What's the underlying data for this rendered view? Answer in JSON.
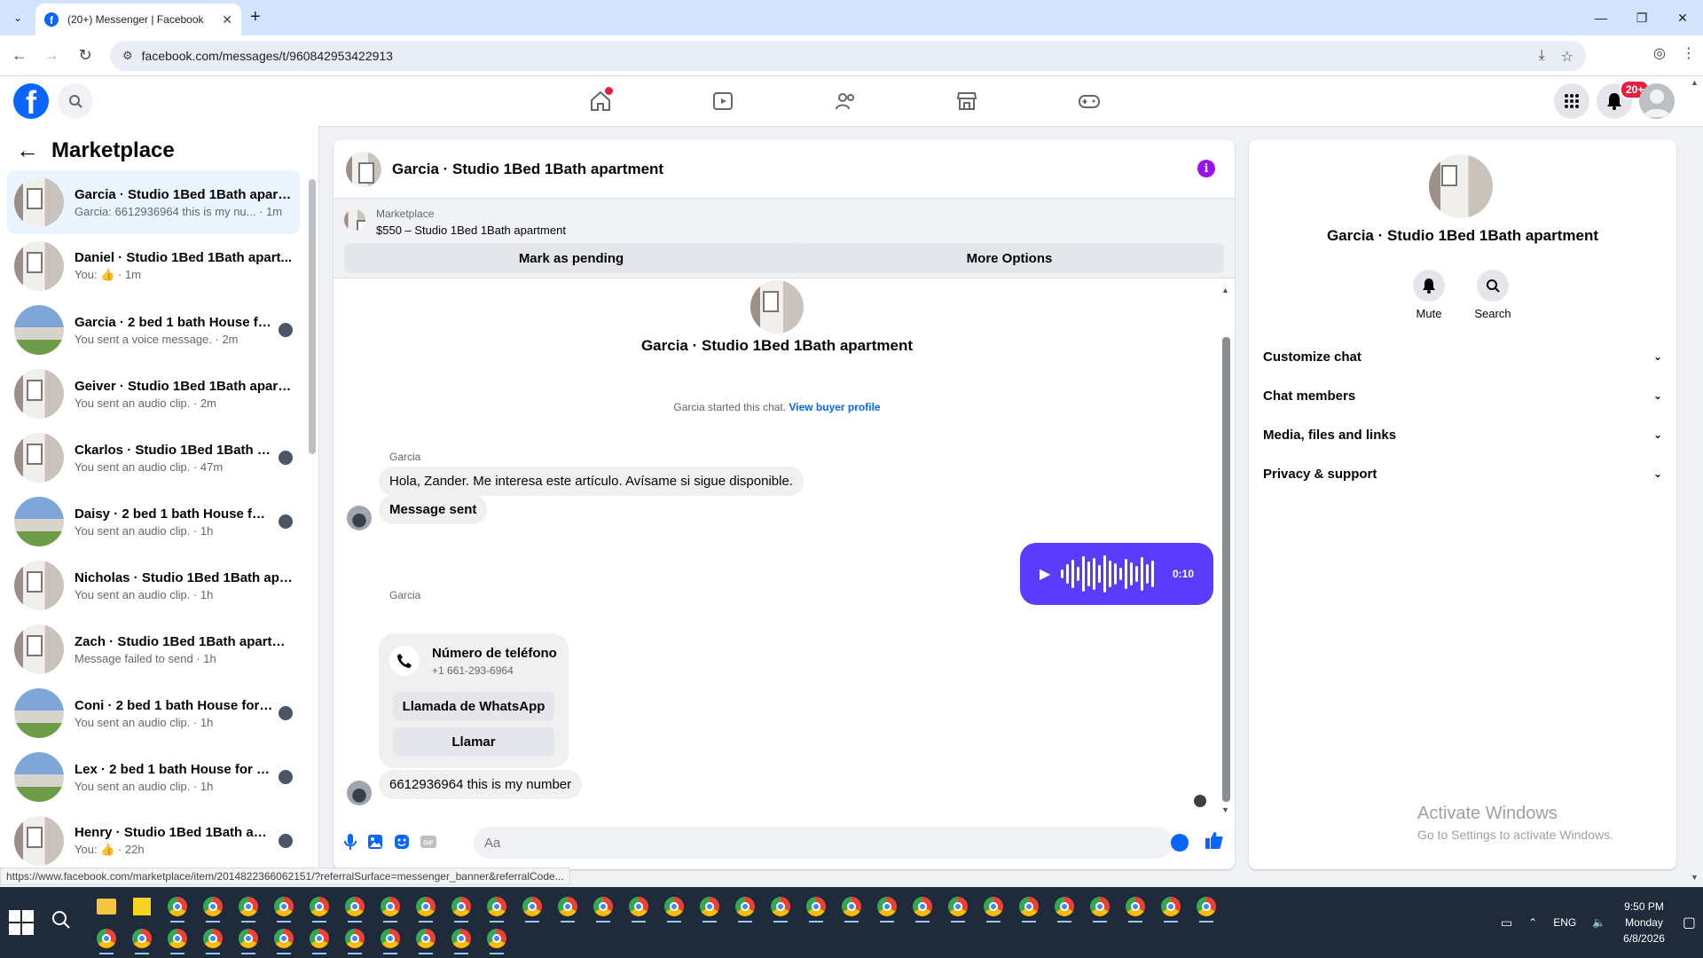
{
  "browser": {
    "tab_title": "(20+) Messenger | Facebook",
    "url": "facebook.com/messages/t/960842953422913",
    "status_url": "https://www.facebook.com/marketplace/item/2014822366062151/?referralSurface=messenger_banner&referralCode..."
  },
  "fb": {
    "notifications_badge": "20+"
  },
  "sidebar": {
    "title": "Marketplace",
    "conversations": [
      {
        "name": "Garcia · Studio 1Bed 1Bath apart...",
        "preview": "Garcia: 6612936964 this is my nu...",
        "time": " · 1m",
        "thumb": "room",
        "active": true
      },
      {
        "name": "Daniel · Studio 1Bed 1Bath apart...",
        "preview": "You: 👍 · 1m",
        "time": "",
        "thumb": "room"
      },
      {
        "name": "Garcia · 2 bed 1 bath House fo...",
        "preview": "You sent a voice message. · 2m",
        "time": "",
        "thumb": "house"
      },
      {
        "name": "Geiver · Studio 1Bed 1Bath apart...",
        "preview": "You sent an audio clip. · 2m",
        "time": "",
        "thumb": "room"
      },
      {
        "name": "Ckarlos · Studio 1Bed 1Bath ap...",
        "preview": "You sent an audio clip. · 47m",
        "time": "",
        "thumb": "room"
      },
      {
        "name": "Daisy · 2 bed 1 bath House for...",
        "preview": "You sent an audio clip. · 1h",
        "time": "",
        "thumb": "house"
      },
      {
        "name": "Nicholas · Studio 1Bed 1Bath apa...",
        "preview": "You sent an audio clip. · 1h",
        "time": "",
        "thumb": "room"
      },
      {
        "name": "Zach · Studio 1Bed 1Bath apartm...",
        "preview": "Message failed to send · 1h",
        "time": "",
        "thumb": "room"
      },
      {
        "name": "Coni · 2 bed 1 bath House for ...",
        "preview": "You sent an audio clip. · 1h",
        "time": "",
        "thumb": "house"
      },
      {
        "name": "Lex · 2 bed 1 bath House for R...",
        "preview": "You sent an audio clip. · 1h",
        "time": "",
        "thumb": "house"
      },
      {
        "name": "Henry · Studio 1Bed 1Bath apa...",
        "preview": "You: 👍 · 22h",
        "time": "",
        "thumb": "room"
      }
    ]
  },
  "chat": {
    "title": "Garcia · Studio 1Bed 1Bath apartment",
    "marketplace_label": "Marketplace",
    "item": "$550 – Studio 1Bed 1Bath apartment",
    "pending_btn": "Mark as pending",
    "options_btn": "More Options",
    "started_text": "Garcia started this chat.",
    "buyer_link": "View buyer profile",
    "sender": "Garcia",
    "msg1": "Hola, Zander. Me interesa este artículo. Avísame si sigue disponible.",
    "msg2": "Message sent",
    "voice_time": "0:10",
    "card_title": "Número de teléfono",
    "card_phone": "+1 661-293-6964",
    "card_btn1": "Llamada de WhatsApp",
    "card_btn2": "Llamar",
    "msg3": "6612936964 this is my number",
    "composer_placeholder": "Aa"
  },
  "info_panel": {
    "name": "Garcia · Studio 1Bed 1Bath apartment",
    "mute": "Mute",
    "search": "Search",
    "sections": [
      "Customize chat",
      "Chat members",
      "Media, files and links",
      "Privacy & support"
    ],
    "watermark_title": "Activate Windows",
    "watermark_sub": "Go to Settings to activate Windows."
  },
  "taskbar": {
    "time": "9:50 PM",
    "day": "Monday",
    "date": "6/8/2026",
    "lang": "ENG"
  }
}
